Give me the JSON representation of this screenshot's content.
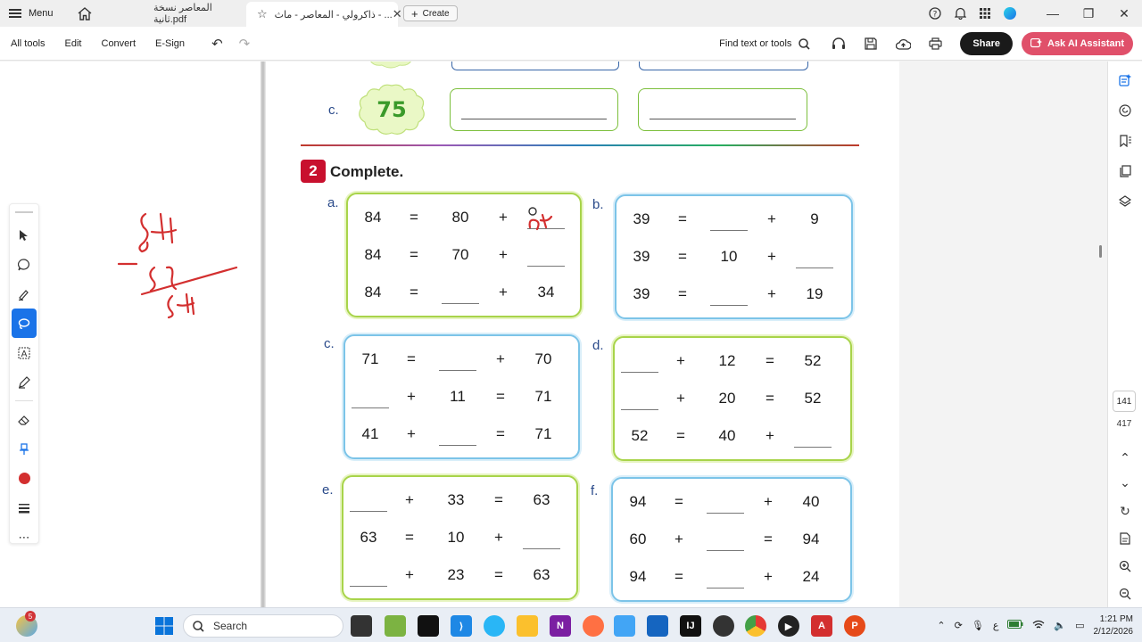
{
  "titlebar": {
    "menu_label": "Menu",
    "tabs": [
      {
        "label": "المعاصر نسخة ثانية.pdf"
      },
      {
        "label": "ذاكرولي - المعاصر - ماث - ..."
      }
    ],
    "create_label": "Create"
  },
  "toolbar": {
    "menus": [
      "All tools",
      "Edit",
      "Convert",
      "E-Sign"
    ],
    "find_label": "Find text or tools",
    "share_label": "Share",
    "ai_label": "Ask AI Assistant"
  },
  "document": {
    "option_c_label": "c.",
    "flower_number": "75",
    "section_number": "2",
    "section_title": "Complete.",
    "problems": [
      {
        "label": "a.",
        "rows": [
          [
            "84",
            "=",
            "80",
            "+",
            ""
          ],
          [
            "84",
            "=",
            "70",
            "+",
            ""
          ],
          [
            "84",
            "=",
            "",
            "+",
            "34"
          ]
        ]
      },
      {
        "label": "b.",
        "rows": [
          [
            "39",
            "=",
            "",
            "+",
            "9"
          ],
          [
            "39",
            "=",
            "10",
            "+",
            ""
          ],
          [
            "39",
            "=",
            "",
            "+",
            "19"
          ]
        ]
      },
      {
        "label": "c.",
        "rows": [
          [
            "71",
            "=",
            "",
            "+",
            "70"
          ],
          [
            "",
            "+",
            "11",
            "=",
            "71"
          ],
          [
            "41",
            "+",
            "",
            "=",
            "71"
          ]
        ]
      },
      {
        "label": "d.",
        "rows": [
          [
            "",
            "+",
            "12",
            "=",
            "52"
          ],
          [
            "",
            "+",
            "20",
            "=",
            "52"
          ],
          [
            "52",
            "=",
            "40",
            "+",
            ""
          ]
        ]
      },
      {
        "label": "e.",
        "rows": [
          [
            "",
            "+",
            "33",
            "=",
            "63"
          ],
          [
            "63",
            "=",
            "10",
            "+",
            ""
          ],
          [
            "",
            "+",
            "23",
            "=",
            "63"
          ]
        ]
      },
      {
        "label": "f.",
        "rows": [
          [
            "94",
            "=",
            "",
            "+",
            "40"
          ],
          [
            "60",
            "+",
            "",
            "=",
            "94"
          ],
          [
            "94",
            "=",
            "",
            "+",
            "24"
          ]
        ]
      }
    ]
  },
  "rightrail": {
    "page_current": "141",
    "page_total": "417"
  },
  "taskbar": {
    "search_label": "Search",
    "notification_count": "5",
    "time": "1:21 PM",
    "date": "2/12/2026",
    "lang": "ع"
  },
  "colors": {
    "accent": "#1a73e8",
    "ai_button": "#e0506a",
    "section_red": "#c8102e",
    "green_border": "#a8d44a",
    "blue_border": "#7cc4e8"
  }
}
